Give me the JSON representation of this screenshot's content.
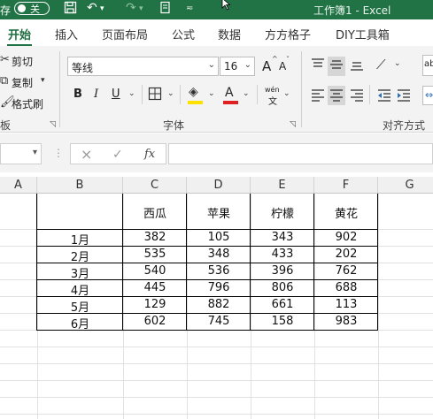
{
  "titlebar": {
    "autosave_label": "存",
    "toggle_label": "关",
    "title": "工作簿1  -  Excel"
  },
  "tabs": [
    {
      "label": "开始",
      "active": true
    },
    {
      "label": "插入"
    },
    {
      "label": "页面布局"
    },
    {
      "label": "公式"
    },
    {
      "label": "数据"
    },
    {
      "label": "方方格子"
    },
    {
      "label": "DIY工具箱"
    }
  ],
  "ribbon": {
    "clipboard": {
      "cut": "剪切",
      "copy": "复制",
      "format_painter": "格式刷",
      "group_label": "板"
    },
    "font": {
      "font_name": "等线",
      "font_size": "16",
      "grow_font": "A",
      "shrink_font": "A",
      "bold": "B",
      "italic": "I",
      "underline": "U",
      "phonetic": "wén",
      "group_label": "字体"
    },
    "alignment": {
      "group_label": "对齐方式"
    },
    "accent_color": "#217346",
    "fill_color": "#ffe100",
    "font_color": "#e02020"
  },
  "formula_bar": {
    "cancel_icon": "×",
    "enter_icon": "✓",
    "fx_label": "fx",
    "content": ""
  },
  "sheet": {
    "columns": [
      "A",
      "B",
      "C",
      "D",
      "E",
      "F",
      "G"
    ],
    "header_row": [
      "",
      "西瓜",
      "苹果",
      "柠檬",
      "黄花"
    ],
    "rows": [
      {
        "label": "1月",
        "values": [
          "382",
          "105",
          "343",
          "902"
        ]
      },
      {
        "label": "2月",
        "values": [
          "535",
          "348",
          "433",
          "202"
        ]
      },
      {
        "label": "3月",
        "values": [
          "540",
          "536",
          "396",
          "762"
        ]
      },
      {
        "label": "4月",
        "values": [
          "445",
          "796",
          "806",
          "688"
        ]
      },
      {
        "label": "5月",
        "values": [
          "129",
          "882",
          "661",
          "113"
        ]
      },
      {
        "label": "6月",
        "values": [
          "602",
          "745",
          "158",
          "983"
        ]
      }
    ]
  }
}
